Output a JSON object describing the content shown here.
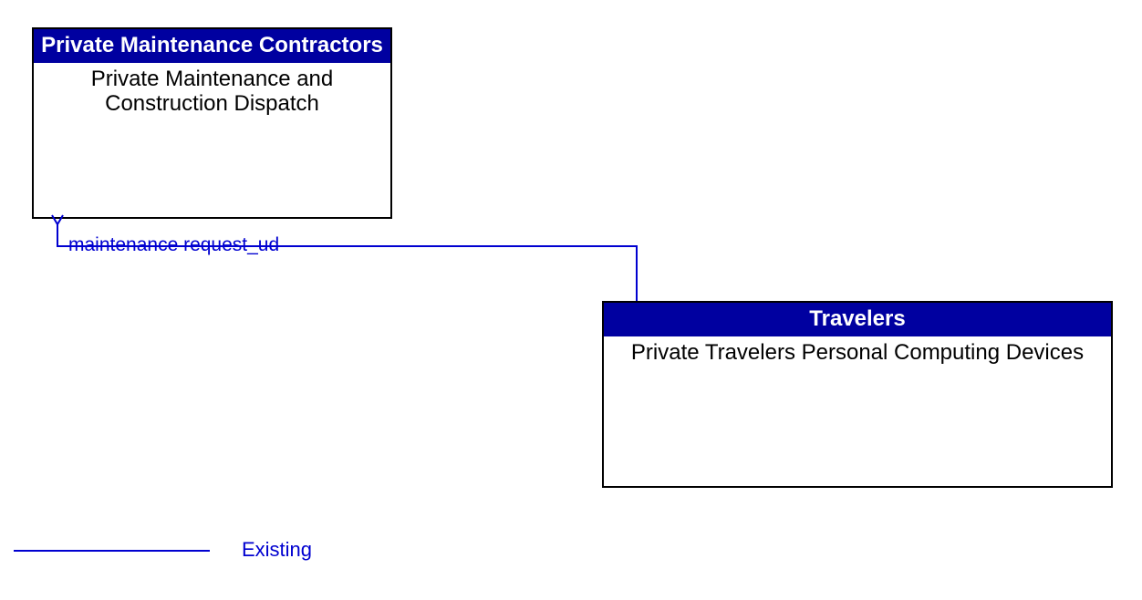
{
  "boxes": {
    "top": {
      "header": "Private Maintenance Contractors",
      "body": "Private Maintenance and Construction Dispatch"
    },
    "bottom": {
      "header": "Travelers",
      "body": "Private Travelers Personal Computing Devices"
    }
  },
  "flow": {
    "label": "maintenance request_ud"
  },
  "legend": {
    "label": "Existing"
  },
  "colors": {
    "header_bg": "#0000A0",
    "line": "#0000D0"
  }
}
